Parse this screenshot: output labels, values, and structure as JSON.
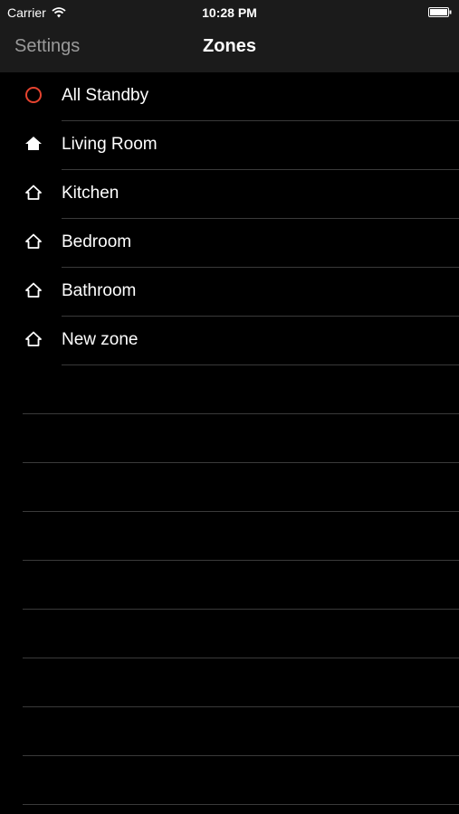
{
  "status_bar": {
    "carrier": "Carrier",
    "time": "10:28 PM",
    "wifi_icon": "wifi-icon",
    "battery_icon": "battery-icon"
  },
  "nav": {
    "back_label": "Settings",
    "title": "Zones"
  },
  "zones": [
    {
      "label": "All Standby",
      "icon": "standby-circle-icon",
      "color": "#e5432f"
    },
    {
      "label": "Living Room",
      "icon": "home-filled-icon",
      "color": "#ffffff"
    },
    {
      "label": "Kitchen",
      "icon": "home-outline-icon",
      "color": "#ffffff"
    },
    {
      "label": "Bedroom",
      "icon": "home-outline-icon",
      "color": "#ffffff"
    },
    {
      "label": "Bathroom",
      "icon": "home-outline-icon",
      "color": "#ffffff"
    },
    {
      "label": "New zone",
      "icon": "home-outline-icon",
      "color": "#ffffff"
    }
  ],
  "colors": {
    "background": "#000000",
    "nav_background": "#1b1b1b",
    "separator": "#3a3a3a",
    "back_text": "#9a9a9a",
    "standby_accent": "#e5432f"
  }
}
